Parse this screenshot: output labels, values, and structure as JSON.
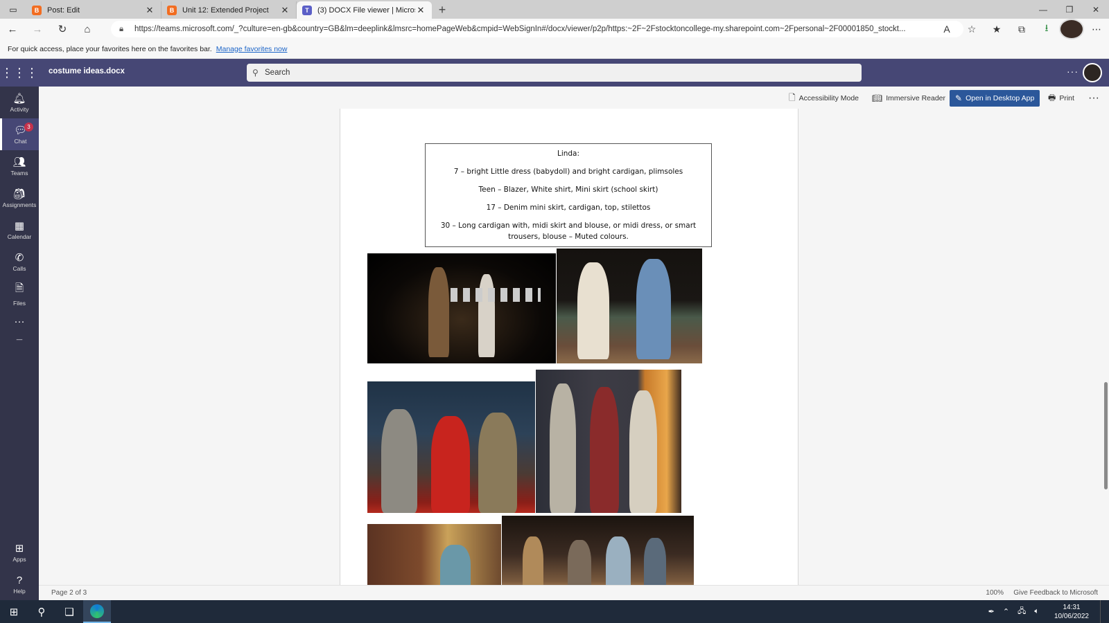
{
  "browser": {
    "tabs": [
      {
        "label": "Post: Edit",
        "favicon_color": "#f26d21",
        "active": false
      },
      {
        "label": "Unit 12: Extended Project",
        "favicon_color": "#f26d21",
        "active": false
      },
      {
        "label": "(3) DOCX File viewer | Microsoft",
        "favicon_color": "#5b5fc7",
        "active": true
      }
    ],
    "url": "https://teams.microsoft.com/_?culture=en-gb&country=GB&lm=deeplink&lmsrc=homePageWeb&cmpid=WebSignIn#/docx/viewer/p2p/https:~2F~2Fstocktoncollege-my.sharepoint.com~2Fpersonal~2F00001850_stockt...",
    "favorites_hint": "For quick access, place your favorites here on the favorites bar.",
    "favorites_link": "Manage favorites now"
  },
  "teams": {
    "doc_title": "costume ideas.docx",
    "search_placeholder": "Search",
    "rail": [
      {
        "label": "Activity",
        "icon": "bell-icon"
      },
      {
        "label": "Chat",
        "icon": "chat-icon",
        "badge": "3"
      },
      {
        "label": "Teams",
        "icon": "teams-icon"
      },
      {
        "label": "Assignments",
        "icon": "assignments-icon"
      },
      {
        "label": "Calendar",
        "icon": "calendar-icon"
      },
      {
        "label": "Calls",
        "icon": "phone-icon"
      },
      {
        "label": "Files",
        "icon": "file-icon"
      }
    ],
    "rail_bottom": [
      {
        "label": "Apps",
        "icon": "apps-icon"
      },
      {
        "label": "Help",
        "icon": "help-icon"
      }
    ],
    "commands": {
      "accessibility": "Accessibility Mode",
      "immersive": "Immersive Reader",
      "open_desktop": "Open in Desktop App",
      "print": "Print"
    }
  },
  "document": {
    "textbox": {
      "heading": "Linda:",
      "lines": [
        "7 – bright  Little dress (babydoll) and bright cardigan, plimsoles",
        "Teen – Blazer, White shirt, Mini skirt (school skirt)",
        "17 – Denim mini skirt, cardigan, top, stilettos",
        "30 – Long cardigan with, midi skirt and blouse, or midi dress, or smart trousers, blouse – Muted colours."
      ]
    }
  },
  "status": {
    "page": "Page 2 of 3",
    "zoom": "100%",
    "feedback": "Give Feedback to Microsoft"
  },
  "taskbar": {
    "time": "14:31",
    "date": "10/06/2022"
  }
}
